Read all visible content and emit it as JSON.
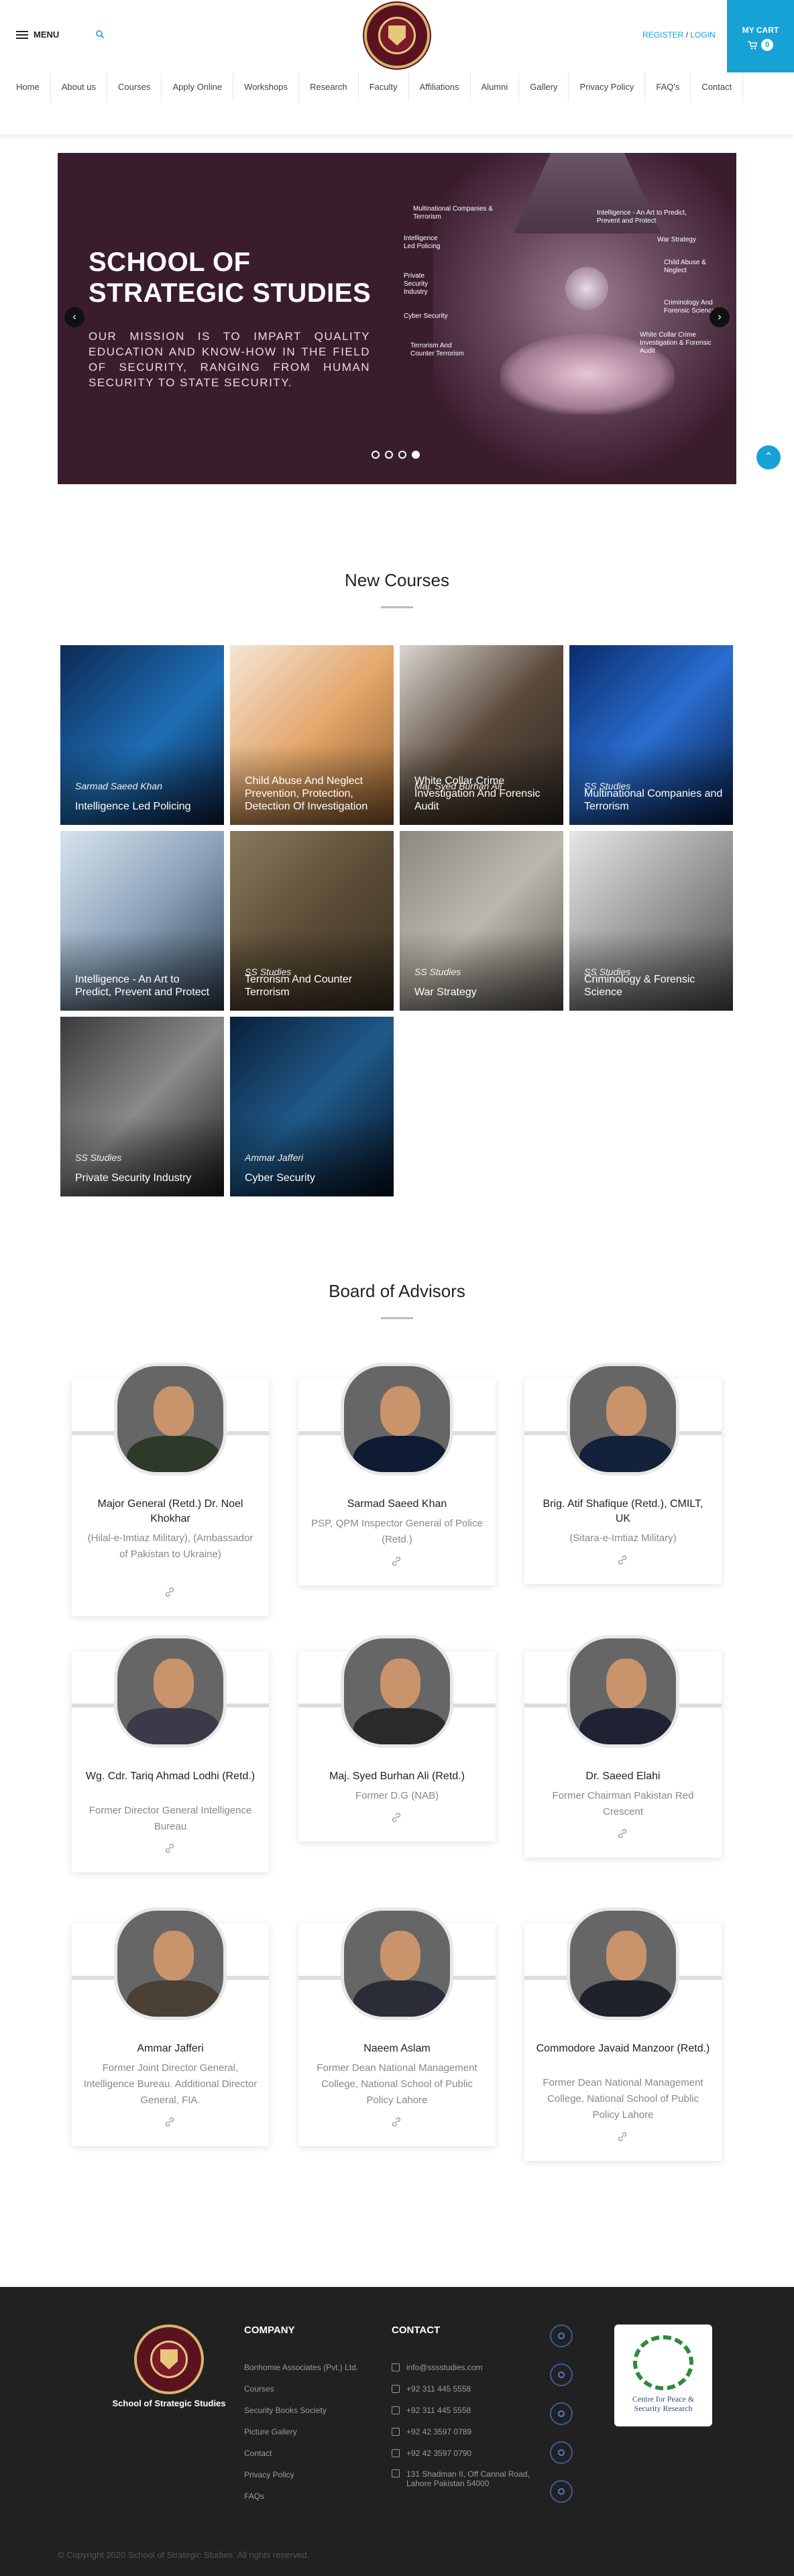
{
  "header": {
    "menu_label": "MENU",
    "register": "REGISTER",
    "sep": " / ",
    "login": "LOGIN",
    "cart_label": "MY CART",
    "cart_count": "0"
  },
  "nav": [
    "Home",
    "About us",
    "Courses",
    "Apply Online",
    "Workshops",
    "Research",
    "Faculty",
    "Affiliations",
    "Alumni",
    "Gallery",
    "Privacy Policy",
    "FAQ's",
    "Contact"
  ],
  "hero": {
    "title_line1": "SCHOOL OF",
    "title_line2": "STRATEGIC STUDIES",
    "mission": "OUR MISSION IS TO IMPART QUALITY EDUCATION AND KNOW-HOW IN THE FIELD OF SECURITY, RANGING FROM HUMAN SECURITY TO STATE SECURITY.",
    "labels": [
      "Multinational Companies & Terrorism",
      "Intelligence - An Art to Predict, Prevent and Protect",
      "Intelligence Led Policing",
      "War Strategy",
      "Private Security Industry",
      "Child Abuse & Neglect",
      "Criminology And Forensic Science",
      "Cyber Security",
      "White Collar Crime Investigation & Forensic Audit",
      "Terrorism And Counter Terrorism"
    ],
    "prev": "‹",
    "next": "›",
    "slide_count": 4,
    "active_slide": 4
  },
  "courses_section": {
    "title": "New Courses",
    "items": [
      {
        "author": "Sarmad Saeed Khan",
        "title": "Intelligence Led Policing",
        "bg": "linear-gradient(135deg,#0e2a55,#1f6fb6 55%,#0b1e3c)"
      },
      {
        "author": "",
        "title": "Child Abuse And Neglect Prevention, Protection, Detection Of Investigation",
        "bg": "linear-gradient(135deg,#f4e6d6,#e3a66a 50%,#8a5a2a)"
      },
      {
        "author": "Maj. Syed Burhan Ali",
        "title": "White Collar Crime Investigation And Forensic Audit",
        "bg": "linear-gradient(135deg,#d9d6d0,#5b4a3c 50%,#2a2420)"
      },
      {
        "author": "SS Studies",
        "title": "Multinational Companies and Terrorism",
        "bg": "linear-gradient(135deg,#0a2b6b,#2a6ed0 50%,#061a40)"
      },
      {
        "author": "",
        "title": "Intelligence - An Art to Predict, Prevent and Protect",
        "bg": "linear-gradient(135deg,#d8e4ee,#8aa2b8 50%,#2b3b4d)"
      },
      {
        "author": "SS Studies",
        "title": "Terrorism And Counter Terrorism",
        "bg": "linear-gradient(135deg,#8a7a5e,#5b4c36 50%,#3a3122)"
      },
      {
        "author": "SS Studies",
        "title": "War Strategy",
        "bg": "linear-gradient(135deg,#8c8880,#bdb8ae 50%,#5a5650)"
      },
      {
        "author": "SS Studies",
        "title": "Criminology & Forensic Science",
        "bg": "linear-gradient(135deg,#e6e6e6,#9a9a9a 50%,#4a4a4a)"
      },
      {
        "author": "SS Studies",
        "title": "Private Security Industry",
        "bg": "linear-gradient(135deg,#3a3a3a,#8a8a8a 50%,#1a1a1a)"
      },
      {
        "author": "Ammar Jafferi",
        "title": "Cyber Security",
        "bg": "linear-gradient(135deg,#0a1f3a,#1f5a8a 50%,#050f1f)"
      }
    ]
  },
  "advisors_section": {
    "title": "Board of Advisors",
    "items": [
      {
        "name": "Major General (Retd.) Dr. Noel Khokhar",
        "role": "(Hilal-e-Imtiaz Military), (Ambassador of Pakistan to Ukraine)",
        "body": "#2d3a2a"
      },
      {
        "name": "Sarmad Saeed Khan",
        "role": "PSP, QPM Inspector General of Police (Retd.)",
        "body": "#0f1a33"
      },
      {
        "name": "Brig. Atif Shafique (Retd.), CMILT, UK",
        "role": "(Sitara-e-Imtiaz Military)",
        "body": "#14213a"
      },
      {
        "name": "Wg. Cdr. Tariq Ahmad Lodhi (Retd.)",
        "role": "Former Director General Intelligence Bureau",
        "body": "#3a3a48"
      },
      {
        "name": "Maj. Syed Burhan Ali (Retd.)",
        "role": "Former D.G (NAB)",
        "body": "#2a2a2a"
      },
      {
        "name": "Dr. Saeed Elahi",
        "role": "Former Chairman Pakistan Red Crescent",
        "body": "#1f2233"
      },
      {
        "name": "Ammar Jafferi",
        "role": "Former Joint Director General, Intelligence Bureau. Additional Director General, FIA.",
        "body": "#4a4036"
      },
      {
        "name": "Naeem Aslam",
        "role": "Former Dean National Management College, National School of Public Policy Lahore",
        "body": "#2a2d38"
      },
      {
        "name": "Commodore Javaid Manzoor (Retd.)",
        "role": "Former Dean National Management College, National School of Public Policy Lahore",
        "body": "#20222a"
      }
    ]
  },
  "footer": {
    "brand": "School of Strategic Studies",
    "company_heading": "COMPANY",
    "company_links": [
      "Bonhomie Associates (Pvt.) Ltd.",
      "Courses",
      "Security Books Society",
      "Picture Gallery",
      "Contact",
      "Privacy Policy",
      "FAQs"
    ],
    "contact_heading": "CONTACT",
    "contacts": [
      "info@sssstudies.com",
      "+92 311 445 5558",
      "+92 311 445 5558",
      "+92 42 3597 0789",
      "+92 42 3597 0790",
      "131 Shadman II, Off Cannal Road, Lahore Pakistan 54000"
    ],
    "badge_text": "Centre for Peace & Security Research",
    "copyright": "© Copyright 2020 School of Strategic Studies. All rights reserved."
  }
}
